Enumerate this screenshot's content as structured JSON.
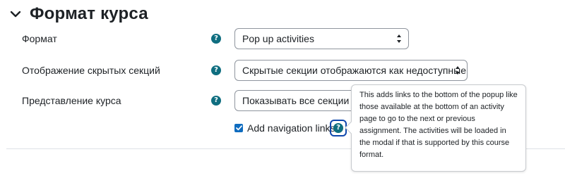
{
  "section": {
    "title": "Формат курса",
    "icon": "chevron-down-icon"
  },
  "fields": [
    {
      "label": "Формат",
      "value": "Pop up activities",
      "help_icon": "question-icon"
    },
    {
      "label": "Отображение скрытых секций",
      "value": "Скрытые секции отображаются как недоступные",
      "help_icon": "question-icon"
    },
    {
      "label": "Представление курса",
      "value": "Показывать все секции на одной странице",
      "help_icon": "question-icon"
    }
  ],
  "nav_links": {
    "checked": true,
    "label": "Add navigation links",
    "help_icon": "question-icon"
  },
  "popover": {
    "text": "This adds links to the bottom of the popup like those available at the bottom of an activity page to go to the next or previous assignment. The activities will be loaded in the modal if that is supported by this course format."
  },
  "colors": {
    "help_icon_bg": "#0f6e80",
    "checkbox_bg": "#0f6cbf",
    "focus_ring": "#0f47ad"
  }
}
